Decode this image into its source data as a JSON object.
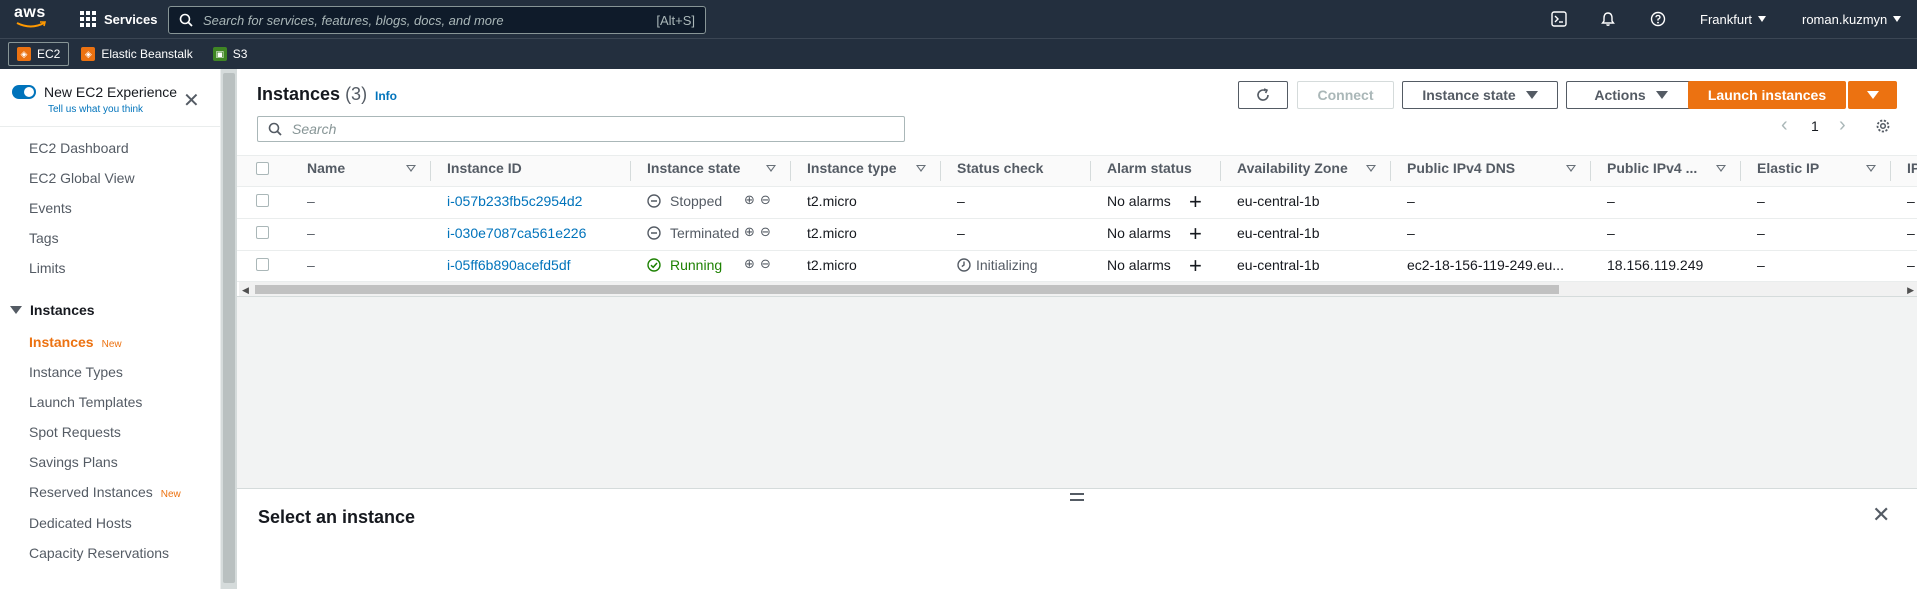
{
  "topnav": {
    "logo": "aws",
    "services": "Services",
    "search_placeholder": "Search for services, features, blogs, docs, and more",
    "search_shortcut": "[Alt+S]",
    "region": "Frankfurt",
    "user": "roman.kuzmyn",
    "icons": [
      "cloudshell-icon",
      "bell-icon",
      "help-icon"
    ]
  },
  "favorites": [
    {
      "label": "EC2",
      "color": "#ec7211",
      "active": true
    },
    {
      "label": "Elastic Beanstalk",
      "color": "#ec7211",
      "active": false
    },
    {
      "label": "S3",
      "color": "#3f8624",
      "active": false
    }
  ],
  "sidebar": {
    "experience_title": "New EC2 Experience",
    "experience_sub": "Tell us what you think",
    "items": [
      {
        "label": "EC2 Dashboard"
      },
      {
        "label": "EC2 Global View"
      },
      {
        "label": "Events"
      },
      {
        "label": "Tags"
      },
      {
        "label": "Limits"
      }
    ],
    "section": "Instances",
    "section_items": [
      {
        "label": "Instances",
        "badge": "New",
        "active": true
      },
      {
        "label": "Instance Types"
      },
      {
        "label": "Launch Templates"
      },
      {
        "label": "Spot Requests"
      },
      {
        "label": "Savings Plans"
      },
      {
        "label": "Reserved Instances",
        "badge": "New"
      },
      {
        "label": "Dedicated Hosts"
      },
      {
        "label": "Capacity Reservations"
      }
    ]
  },
  "header": {
    "title": "Instances",
    "count": "(3)",
    "info": "Info",
    "connect": "Connect",
    "instance_state": "Instance state",
    "actions": "Actions",
    "launch": "Launch instances",
    "search_placeholder": "Search",
    "page": "1"
  },
  "table": {
    "columns": [
      "Name",
      "Instance ID",
      "Instance state",
      "Instance type",
      "Status check",
      "Alarm status",
      "Availability Zone",
      "Public IPv4 DNS",
      "Public IPv4 ...",
      "Elastic IP",
      "IP"
    ],
    "rows": [
      {
        "name": "–",
        "id": "i-057b233fb5c2954d2",
        "state": "Stopped",
        "type": "t2.micro",
        "status": "–",
        "alarm": "No alarms",
        "az": "eu-central-1b",
        "dns": "–",
        "ipv4": "–",
        "eip": "–",
        "ip": "–"
      },
      {
        "name": "–",
        "id": "i-030e7087ca561e226",
        "state": "Terminated",
        "type": "t2.micro",
        "status": "–",
        "alarm": "No alarms",
        "az": "eu-central-1b",
        "dns": "–",
        "ipv4": "–",
        "eip": "–",
        "ip": "–"
      },
      {
        "name": "–",
        "id": "i-05ff6b890acefd5df",
        "state": "Running",
        "type": "t2.micro",
        "status": "Initializing",
        "alarm": "No alarms",
        "az": "eu-central-1b",
        "dns": "ec2-18-156-119-249.eu...",
        "ipv4": "18.156.119.249",
        "eip": "–",
        "ip": "–"
      }
    ]
  },
  "details": {
    "title": "Select an instance"
  },
  "colors": {
    "nav_bg": "#232f3e",
    "accent": "#ec7211",
    "link": "#0073bb",
    "running": "#1d8102"
  }
}
